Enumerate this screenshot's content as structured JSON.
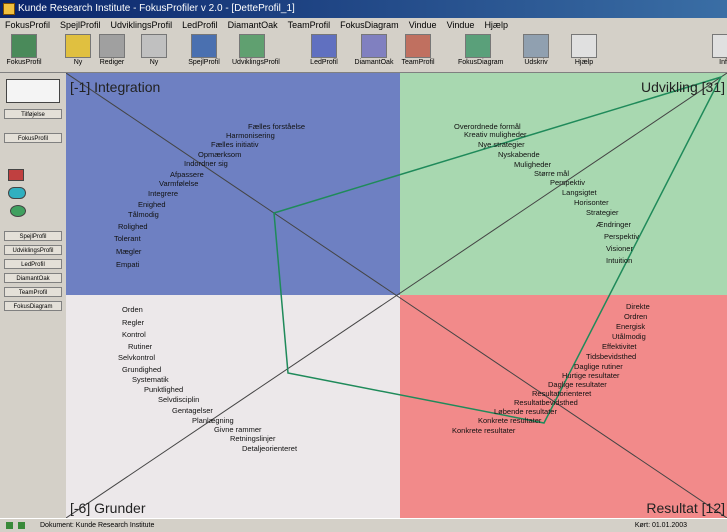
{
  "window": {
    "title": "Kunde Research Institute - FokusProfiler v 2.0 - [DetteProfil_1]"
  },
  "menu": [
    "FokusProfil",
    "SpejlProfil",
    "UdviklingsProfil",
    "LedProfil",
    "DiamantOak",
    "TeamProfil",
    "FokusDiagram",
    "Vindue",
    "Vindue",
    "Hjælp"
  ],
  "toolbar": [
    {
      "label": "FokusProfil",
      "icon": "profile-icon",
      "color": "#4a8a5a"
    },
    {
      "label": "Ny",
      "icon": "new-icon",
      "color": "#e0c040"
    },
    {
      "label": "Rediger",
      "icon": "edit-icon",
      "color": "#a0a0a0"
    },
    {
      "label": "Ny",
      "icon": "question-icon",
      "color": "#c0c0c0"
    },
    {
      "label": "SpejlProfil",
      "icon": "mirror-icon",
      "color": "#4a70b0"
    },
    {
      "label": "UdviklingsProfil",
      "icon": "chart-icon",
      "color": "#60a070"
    },
    {
      "label": "LedProfil",
      "icon": "lead-icon",
      "color": "#6070c0"
    },
    {
      "label": "DiamantOak",
      "icon": "diamond-icon",
      "color": "#8080c0"
    },
    {
      "label": "TeamProfil",
      "icon": "team-icon",
      "color": "#c07060"
    },
    {
      "label": "FokusDiagram",
      "icon": "diagram-icon",
      "color": "#5aa07a"
    },
    {
      "label": "Udskriv",
      "icon": "print-icon",
      "color": "#90a0b0"
    },
    {
      "label": "Hjælp",
      "icon": "help-icon",
      "color": "#e0e0e0"
    },
    {
      "label": "Info",
      "icon": "info-icon",
      "color": "#e0e0e0"
    }
  ],
  "sidebar": {
    "buttons": [
      "Tilføjelse",
      "FokusProfil",
      "SpejlProfil",
      "UdviklingsProfil",
      "LedProfil",
      "DiamantOak",
      "TeamProfil",
      "FokusDiagram"
    ]
  },
  "quadrants": {
    "integration": {
      "label": "[-1] Integration",
      "color": "#6e80c2",
      "words": [
        "Fælles forståelse",
        "Harmonisering",
        "Fælles initiativ",
        "Opmærksom",
        "Indordner sig",
        "Afpassere",
        "Varmfølelse",
        "Integrere",
        "Enighed",
        "Tålmodig",
        "Rolighed",
        "Tolerant",
        "Mægler",
        "Empati"
      ]
    },
    "udvikling": {
      "label": "Udvikling [31]",
      "color": "#a8d8b0",
      "words": [
        "Overordnede formål",
        "Kreativ muligheder",
        "Nye strategier",
        "Nyskabende",
        "Muligheder",
        "Større mål",
        "Perspektiv",
        "Langsigtet",
        "Horisonter",
        "Strategier",
        "Ændringer",
        "Perspektiv",
        "Visioner",
        "Intuition"
      ]
    },
    "grunder": {
      "label": "[-6] Grunder",
      "color": "#ece8ea",
      "words": [
        "Orden",
        "Regler",
        "Kontrol",
        "Rutiner",
        "Selvkontrol",
        "Grundighed",
        "Systematik",
        "Punktlighed",
        "Selvdisciplin",
        "Gentagelser",
        "Planlægning",
        "Givne rammer",
        "Retningslinjer",
        "Detaljeorienteret"
      ]
    },
    "resultat": {
      "label": "Resultat [12]",
      "color": "#f28a8a",
      "words": [
        "Direkte",
        "Ordren",
        "Energisk",
        "Utålmodig",
        "Effektivitet",
        "Tidsbevidsthed",
        "Daglige rutiner",
        "Hurtige resultater",
        "Daglige resultater",
        "Resultatorienteret",
        "Resultatbevidsthed",
        "Løbende resultater",
        "Konkrete resultater",
        "Konkrete resultater"
      ]
    }
  },
  "profile": {
    "line_color": "#1f8a5a",
    "scores": {
      "integration": -1,
      "udvikling": 31,
      "grunder": -6,
      "resultat": 12
    }
  },
  "status": {
    "left": "Dokument: Kunde Research Institute",
    "right": "Kørt: 01.01.2003"
  }
}
